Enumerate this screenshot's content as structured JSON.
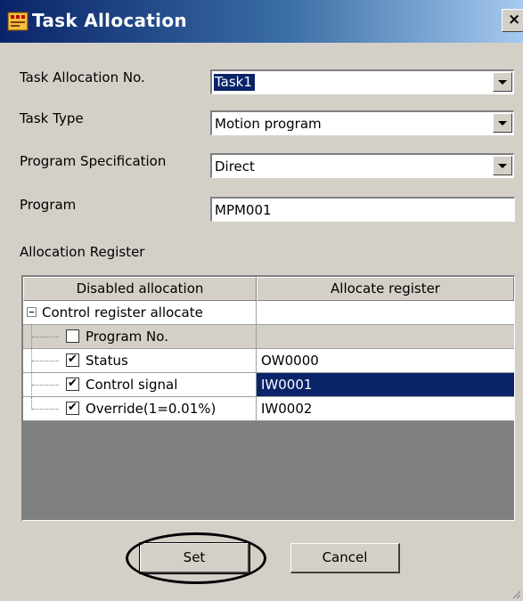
{
  "window": {
    "title": "Task Allocation",
    "close_glyph": "×",
    "icon": "task-allocation-app-icon"
  },
  "form": {
    "task_no_label": "Task Allocation No.",
    "task_no_value": "Task1",
    "task_type_label": "Task Type",
    "task_type_value": "Motion program",
    "program_spec_label": "Program Specification",
    "program_spec_value": "Direct",
    "program_label": "Program",
    "program_value": "MPM001"
  },
  "allocation": {
    "section_label": "Allocation Register",
    "columns": [
      "Disabled allocation",
      "Allocate register"
    ],
    "group_label": "Control register allocate",
    "rows": [
      {
        "label": "Program No.",
        "checked": false,
        "register": ""
      },
      {
        "label": "Status",
        "checked": true,
        "register": "OW0000"
      },
      {
        "label": "Control signal",
        "checked": true,
        "register": "IW0001"
      },
      {
        "label": "Override(1=0.01%)",
        "checked": true,
        "register": "IW0002"
      }
    ],
    "check_glyph": "✔"
  },
  "buttons": {
    "set_label": "Set",
    "cancel_label": "Cancel"
  },
  "colors": {
    "selection": "#0a246a",
    "dialog_bg": "#d4d0c8"
  }
}
